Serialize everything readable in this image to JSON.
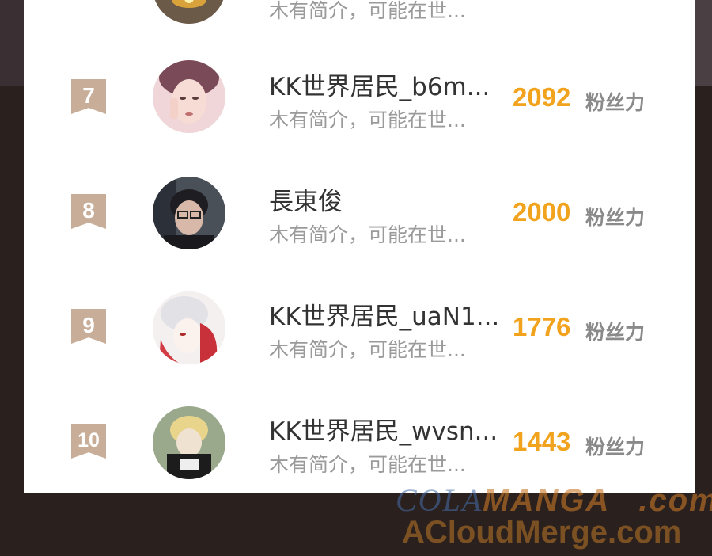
{
  "rows": [
    {
      "rank": "",
      "name": "",
      "bio": "木有简介，可能在世...",
      "score": "",
      "unit": ""
    },
    {
      "rank": "7",
      "name": "KK世界居民_b6m...",
      "bio": "木有简介，可能在世...",
      "score": "2092",
      "unit": "粉丝力"
    },
    {
      "rank": "8",
      "name": "長東俊",
      "bio": "木有简介，可能在世...",
      "score": "2000",
      "unit": "粉丝力"
    },
    {
      "rank": "9",
      "name": "KK世界居民_uaN1...",
      "bio": "木有简介，可能在世...",
      "score": "1776",
      "unit": "粉丝力"
    },
    {
      "rank": "10",
      "name": "KK世界居民_wvsn...",
      "bio": "木有简介，可能在世...",
      "score": "1443",
      "unit": "粉丝力"
    }
  ],
  "watermark": {
    "line1_a": "COLA",
    "line1_b": "MANGA",
    "line1_c": ".com",
    "line2": "ACloudMerge.com"
  },
  "colors": {
    "score": "#f2a31e",
    "rank_badge": "#c8ae98",
    "panel": "#ffffff"
  }
}
